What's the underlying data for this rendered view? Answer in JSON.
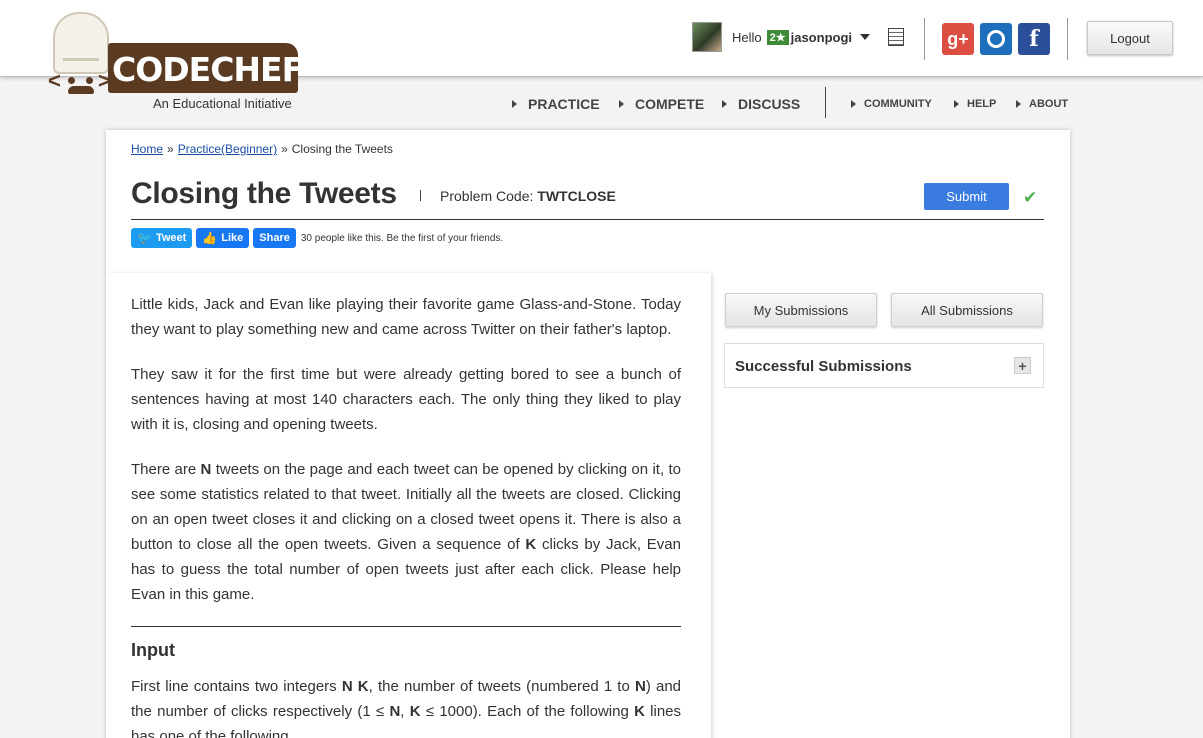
{
  "logo": {
    "wordmark": "CODECHEF",
    "tagline": "An Educational Initiative"
  },
  "user": {
    "greeting": "Hello",
    "rating_badge": "2★",
    "username": "jasonpogi"
  },
  "social": {
    "google": "g+",
    "facebook": "f"
  },
  "header": {
    "logout_label": "Logout"
  },
  "nav": {
    "primary": [
      "PRACTICE",
      "COMPETE",
      "DISCUSS"
    ],
    "secondary": [
      "COMMUNITY",
      "HELP",
      "ABOUT"
    ]
  },
  "breadcrumb": {
    "home": "Home",
    "sep": "»",
    "practice": "Practice(Beginner)",
    "current": "Closing the Tweets"
  },
  "problem": {
    "title": "Closing the Tweets",
    "code_label": "Problem Code:",
    "code": "TWTCLOSE",
    "submit_label": "Submit"
  },
  "share": {
    "tweet_label": "Tweet",
    "like_label": "Like",
    "share_label": "Share",
    "likes_text": "30 people like this. Be the first of your friends."
  },
  "statement": {
    "p1": "Little kids, Jack and Evan like playing their favorite game Glass-and-Stone. Today they want to play something new and came across Twitter on their father's laptop.",
    "p2": "They saw it for the first time but were already getting bored to see a bunch of sentences having at most 140 characters each. The only thing they liked to play with it is, closing and opening tweets.",
    "p3_a": "There are ",
    "p3_n": "N",
    "p3_b": " tweets on the page and each tweet can be opened by clicking on it, to see some statistics related to that tweet. Initially all the tweets are closed. Clicking on an open tweet closes it and clicking on a closed tweet opens it. There is also a button to close all the open tweets. Given a sequence of ",
    "p3_k": "K",
    "p3_c": " clicks by Jack, Evan has to guess the total number of open tweets just after each click. Please help Evan in this game.",
    "input_heading": "Input",
    "in_a": "First line contains two integers ",
    "in_nk": "N K",
    "in_b": ", the number of tweets (numbered 1 to ",
    "in_n": "N",
    "in_c": ") and the number of clicks respectively (1 ≤ ",
    "in_n2": "N",
    "in_d": ", ",
    "in_k": "K",
    "in_e": " ≤ 1000). Each of the following ",
    "in_k2": "K",
    "in_f": " lines has one of the following."
  },
  "sidebar": {
    "my_submissions": "My Submissions",
    "all_submissions": "All Submissions",
    "successful_submissions": "Successful Submissions",
    "expand_symbol": "+"
  },
  "colors": {
    "brand_brown": "#5b3a22",
    "submit_blue": "#3a7be0",
    "link_blue": "#1a4ea5",
    "check_green": "#4caf50"
  }
}
